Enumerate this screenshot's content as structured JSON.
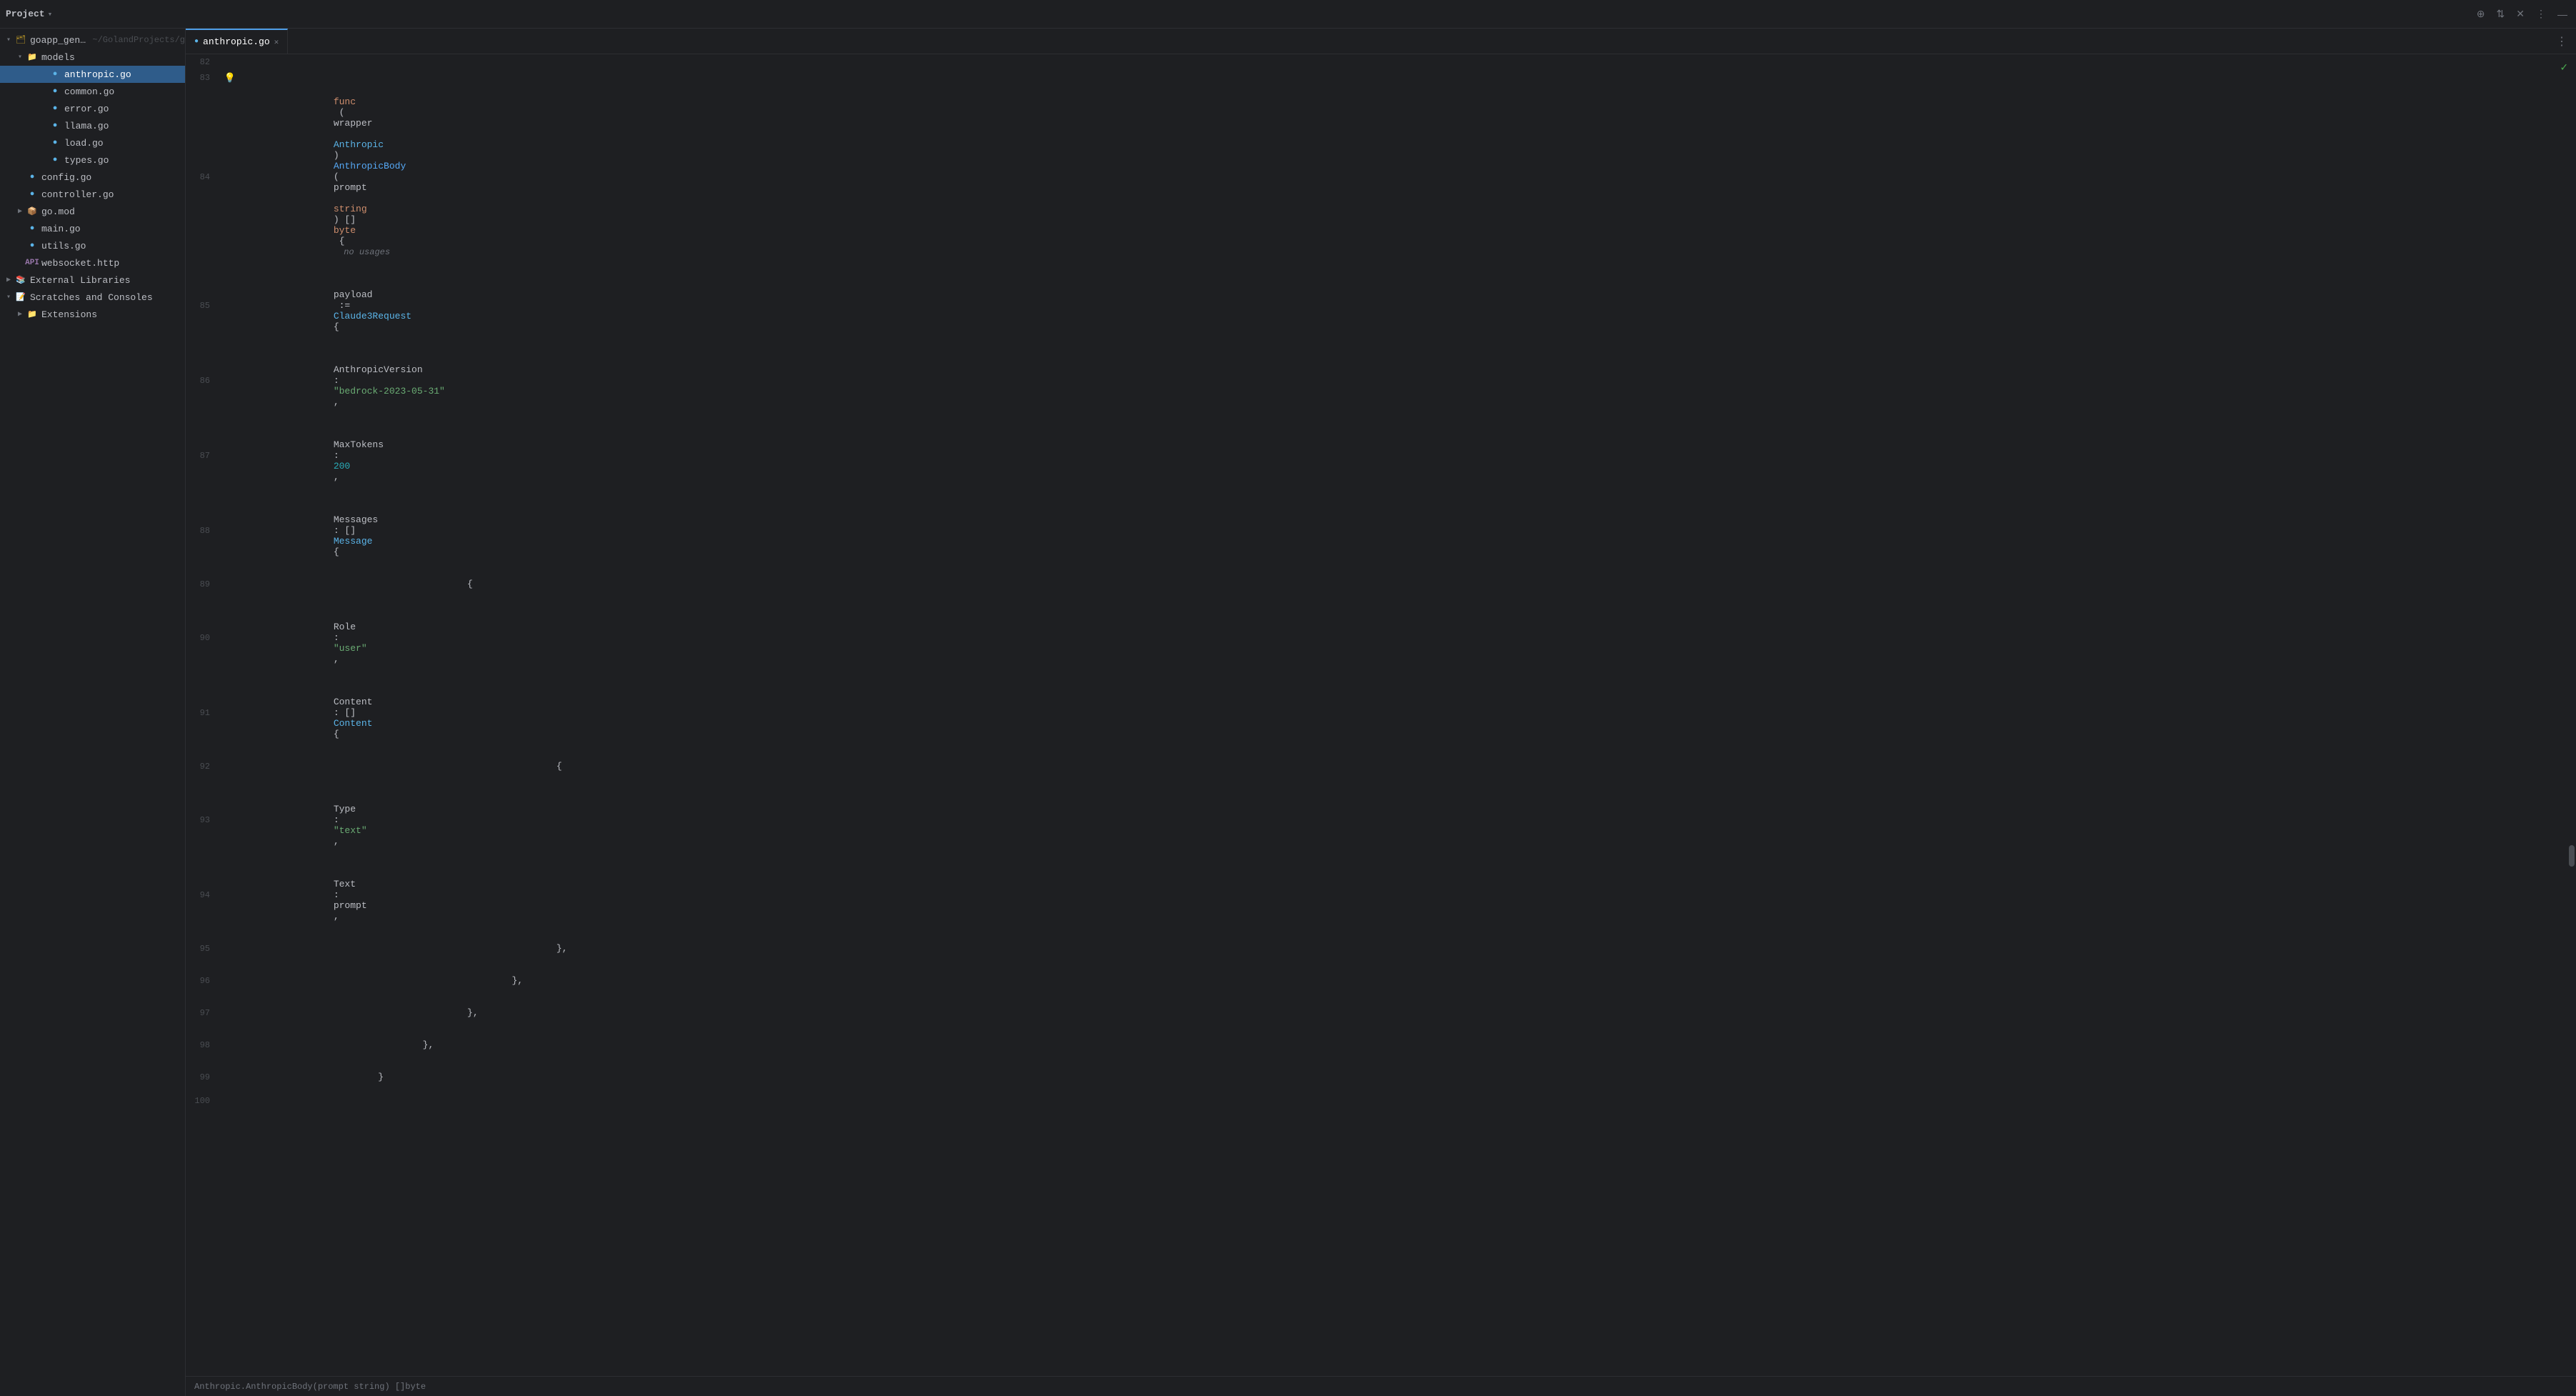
{
  "topbar": {
    "project_label": "Project",
    "chevron": "▾"
  },
  "sidebar": {
    "root": {
      "label": "goapp_genai",
      "path": "~/GolandProjects/g",
      "expanded": true
    },
    "items": [
      {
        "id": "goapp_genai",
        "label": "goapp_genai ~/GolandProjects/g",
        "indent": 0,
        "type": "root",
        "arrow": "▾",
        "selected": false
      },
      {
        "id": "models",
        "label": "models",
        "indent": 1,
        "type": "folder",
        "arrow": "▾",
        "selected": false
      },
      {
        "id": "anthropic.go",
        "label": "anthropic.go",
        "indent": 2,
        "type": "go",
        "arrow": "",
        "selected": true
      },
      {
        "id": "common.go",
        "label": "common.go",
        "indent": 2,
        "type": "go",
        "arrow": "",
        "selected": false
      },
      {
        "id": "error.go",
        "label": "error.go",
        "indent": 2,
        "type": "go",
        "arrow": "",
        "selected": false
      },
      {
        "id": "llama.go",
        "label": "llama.go",
        "indent": 2,
        "type": "go",
        "arrow": "",
        "selected": false
      },
      {
        "id": "load.go",
        "label": "load.go",
        "indent": 2,
        "type": "go",
        "arrow": "",
        "selected": false
      },
      {
        "id": "types.go",
        "label": "types.go",
        "indent": 2,
        "type": "go",
        "arrow": "",
        "selected": false
      },
      {
        "id": "config.go",
        "label": "config.go",
        "indent": 1,
        "type": "go",
        "arrow": "",
        "selected": false
      },
      {
        "id": "controller.go",
        "label": "controller.go",
        "indent": 1,
        "type": "go",
        "arrow": "",
        "selected": false
      },
      {
        "id": "go.mod",
        "label": "go.mod",
        "indent": 1,
        "type": "mod",
        "arrow": "▶",
        "selected": false
      },
      {
        "id": "main.go",
        "label": "main.go",
        "indent": 1,
        "type": "go",
        "arrow": "",
        "selected": false
      },
      {
        "id": "utils.go",
        "label": "utils.go",
        "indent": 1,
        "type": "go",
        "arrow": "",
        "selected": false
      },
      {
        "id": "websocket.http",
        "label": "websocket.http",
        "indent": 1,
        "type": "api",
        "arrow": "",
        "selected": false
      },
      {
        "id": "external-libraries",
        "label": "External Libraries",
        "indent": 0,
        "type": "ext",
        "arrow": "▶",
        "selected": false
      },
      {
        "id": "scratches",
        "label": "Scratches and Consoles",
        "indent": 0,
        "type": "scratch",
        "arrow": "▾",
        "selected": false
      },
      {
        "id": "extensions",
        "label": "Extensions",
        "indent": 1,
        "type": "folder",
        "arrow": "▶",
        "selected": false
      }
    ]
  },
  "tabs": [
    {
      "id": "anthropic.go",
      "label": "anthropic.go",
      "active": true
    }
  ],
  "editor": {
    "lines": [
      {
        "num": "82",
        "code": ""
      },
      {
        "num": "83",
        "code": "  💡",
        "bulb": true
      },
      {
        "num": "84",
        "code": "func_AnthropicBody",
        "special": "func_line"
      },
      {
        "num": "85",
        "code": "\tpayload := Claude3Request{"
      },
      {
        "num": "86",
        "code": "\t\tAnthropicVersion: \"bedrock-2023-05-31\","
      },
      {
        "num": "87",
        "code": "\t\tMaxTokens:        200,"
      },
      {
        "num": "88",
        "code": "\t\tMessages: []Message{"
      },
      {
        "num": "89",
        "code": "\t\t\t{"
      },
      {
        "num": "90",
        "code": "\t\t\t\tRole: \"user\","
      },
      {
        "num": "91",
        "code": "\t\t\t\tContent: []Content{"
      },
      {
        "num": "92",
        "code": "\t\t\t\t\t{"
      },
      {
        "num": "93",
        "code": "\t\t\t\t\t\tType: \"text\","
      },
      {
        "num": "94",
        "code": "\t\t\t\t\t\tText: prompt,"
      },
      {
        "num": "95",
        "code": "\t\t\t\t\t},"
      },
      {
        "num": "96",
        "code": "\t\t\t\t},"
      },
      {
        "num": "97",
        "code": "\t\t\t},"
      },
      {
        "num": "98",
        "code": "\t\t},"
      },
      {
        "num": "99",
        "code": "\t}"
      },
      {
        "num": "100",
        "code": ""
      }
    ],
    "status": "Anthropic.AnthropicBody(prompt string) []byte"
  },
  "icons": {
    "add": "⊕",
    "updown": "⇅",
    "close": "✕",
    "more": "⋮",
    "minimize": "—",
    "chevron_down": "▾",
    "chevron_right": "▶",
    "settings": "⋮",
    "check": "✓"
  }
}
